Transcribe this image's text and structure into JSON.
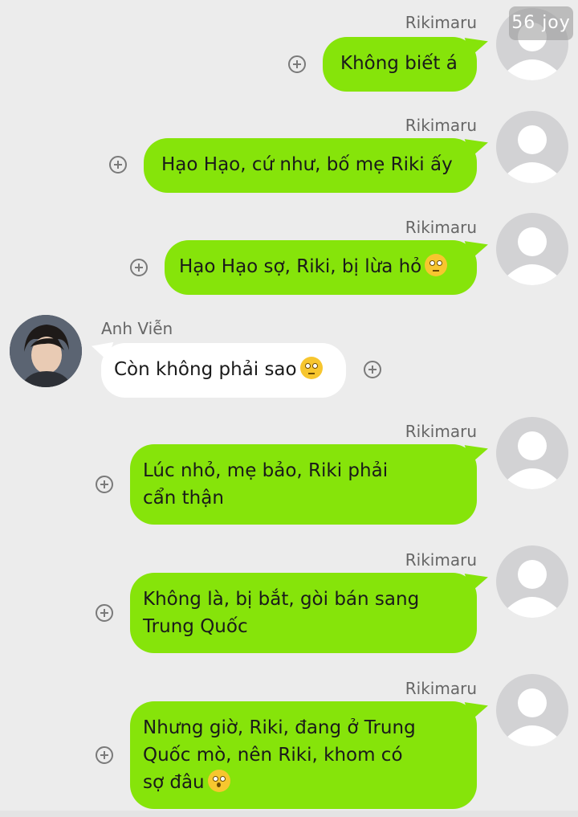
{
  "watermark": "56 joy",
  "colors": {
    "outgoing_bubble": "#86e40a",
    "incoming_bubble": "#ffffff",
    "background": "#ececec"
  },
  "messages": [
    {
      "sender": "Rikimaru",
      "text": "Không biết á",
      "direction": "out"
    },
    {
      "sender": "Rikimaru",
      "text": "Hạo Hạo, cứ như, bố mẹ Riki ấy",
      "direction": "out"
    },
    {
      "sender": "Rikimaru",
      "text": "Hạo Hạo sợ, Riki, bị lừa hỏ",
      "emoji": "face-with-rolling-eyes",
      "direction": "out"
    },
    {
      "sender": "Anh Viễn",
      "text": "Còn không phải sao",
      "emoji": "face-with-rolling-eyes",
      "direction": "in"
    },
    {
      "sender": "Rikimaru",
      "line1": "Lúc nhỏ, mẹ bảo, Riki phải",
      "line2": "cẩn thận",
      "direction": "out"
    },
    {
      "sender": "Rikimaru",
      "line1": "Không là, bị bắt, gòi bán sang",
      "line2": "Trung Quốc",
      "direction": "out"
    },
    {
      "sender": "Rikimaru",
      "line1": "Nhưng giờ, Riki, đang ở Trung",
      "line2": "Quốc mò, nên Riki, khom có",
      "line3": "sợ đâu",
      "emoji": "kissing-face",
      "direction": "out"
    }
  ]
}
